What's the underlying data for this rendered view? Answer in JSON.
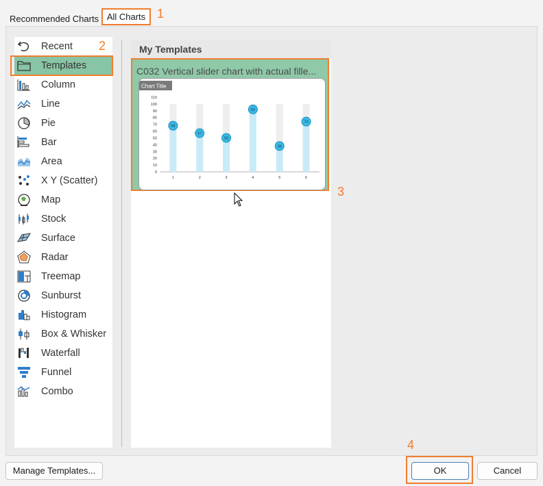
{
  "tabs": {
    "recommended": "Recommended Charts",
    "all": "All Charts"
  },
  "markers": {
    "m1": "1",
    "m2": "2",
    "m3": "3",
    "m4": "4"
  },
  "sidebar": {
    "items": [
      {
        "label": "Recent",
        "icon": "undo-icon"
      },
      {
        "label": "Templates",
        "icon": "folder-icon"
      },
      {
        "label": "Column",
        "icon": "column-chart-icon"
      },
      {
        "label": "Line",
        "icon": "line-chart-icon"
      },
      {
        "label": "Pie",
        "icon": "pie-chart-icon"
      },
      {
        "label": "Bar",
        "icon": "bar-chart-icon"
      },
      {
        "label": "Area",
        "icon": "area-chart-icon"
      },
      {
        "label": "X Y (Scatter)",
        "icon": "scatter-chart-icon"
      },
      {
        "label": "Map",
        "icon": "map-chart-icon"
      },
      {
        "label": "Stock",
        "icon": "stock-chart-icon"
      },
      {
        "label": "Surface",
        "icon": "surface-chart-icon"
      },
      {
        "label": "Radar",
        "icon": "radar-chart-icon"
      },
      {
        "label": "Treemap",
        "icon": "treemap-chart-icon"
      },
      {
        "label": "Sunburst",
        "icon": "sunburst-chart-icon"
      },
      {
        "label": "Histogram",
        "icon": "histogram-chart-icon"
      },
      {
        "label": "Box & Whisker",
        "icon": "box-whisker-chart-icon"
      },
      {
        "label": "Waterfall",
        "icon": "waterfall-chart-icon"
      },
      {
        "label": "Funnel",
        "icon": "funnel-chart-icon"
      },
      {
        "label": "Combo",
        "icon": "combo-chart-icon"
      }
    ]
  },
  "main": {
    "heading": "My Templates",
    "template_title": "C032 Vertical slider chart with actual fille..."
  },
  "chart_data": {
    "type": "bar",
    "title": "Chart Title",
    "categories": [
      "1",
      "2",
      "3",
      "4",
      "5",
      "6"
    ],
    "values": [
      68,
      57,
      50,
      92,
      38,
      74
    ],
    "max_values": [
      100,
      100,
      100,
      100,
      100,
      100
    ],
    "yticks": [
      0,
      10,
      20,
      30,
      40,
      50,
      60,
      70,
      80,
      90,
      100,
      110
    ],
    "ylim": [
      0,
      110
    ],
    "colors": {
      "fill": "#c9ebf7",
      "track": "#eeeeee",
      "marker": "#3bb8e4",
      "marker_stroke": "#1a8fbf"
    }
  },
  "buttons": {
    "manage": "Manage Templates...",
    "ok": "OK",
    "cancel": "Cancel"
  },
  "colors": {
    "highlight": "#f07d2e",
    "selected": "#88c5a4"
  }
}
